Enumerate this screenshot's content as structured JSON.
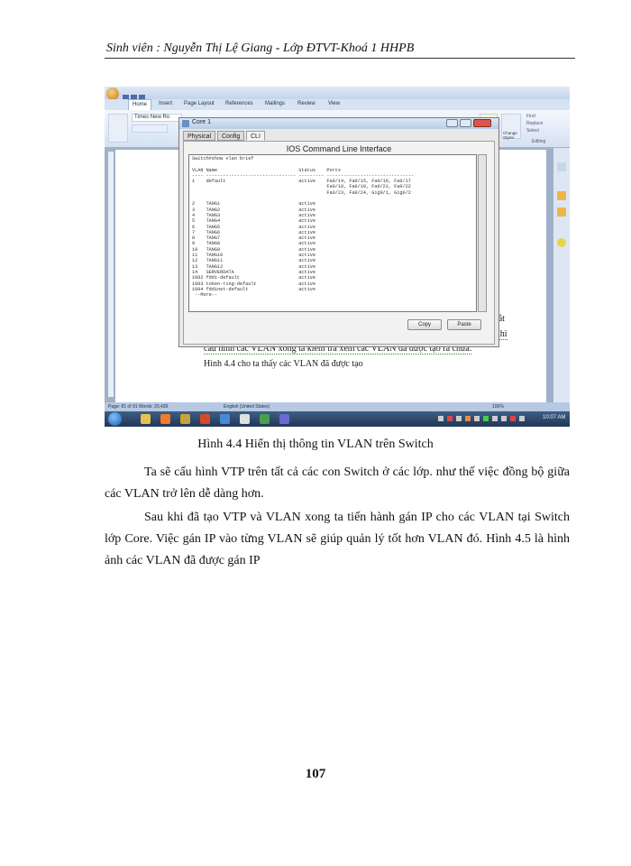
{
  "header": {
    "text": "Sinh viên : Nguyễn Thị Lệ Giang - Lớp ĐTVT-Khoá 1 HHPB"
  },
  "screenshot": {
    "word_tabs": [
      "Home",
      "Insert",
      "Page Layout",
      "References",
      "Mailings",
      "Review",
      "View"
    ],
    "font_box": "Times New Ro",
    "ribbon_right": [
      "Find",
      "Replace",
      "Select",
      "Change Styles",
      "Editing"
    ],
    "doc_lines": [
      "cấu hình các VLAN xong ta kiểm tra xem các VLAN đã được tạo ra chưa.",
      "Hình 4.4 cho ta thấy các VLAN đã được tạo"
    ],
    "doc_right_fragments": [
      "N bắt",
      "ý.Khi"
    ],
    "status_left": "Page: 81 of 91    Words: 20,439",
    "status_lang": "English (United States)",
    "zoom": "100%",
    "tray_time": "10:07 AM",
    "cli": {
      "title": "Core 1",
      "tabs": [
        "Physical",
        "Config",
        "CLI"
      ],
      "heading": "IOS Command Line Interface",
      "terminal_lines": [
        "Switch#show vlan brief",
        "",
        "VLAN Name                             Status    Ports",
        "---- -------------------------------- --------- -------------------------------",
        "1    default                          active    Fa0/14, Fa0/15, Fa0/16, Fa0/17",
        "                                                Fa0/18, Fa0/19, Fa0/21, Fa0/22",
        "                                                Fa0/23, Fa0/24, Gig0/1, Gig0/2",
        "",
        "2    TANG1                            active",
        "3    TANG2                            active",
        "4    TANG3                            active",
        "5    TANG4                            active",
        "6    TANG5                            active",
        "7    TANG6                            active",
        "8    TANG7                            active",
        "9    TANG8                            active",
        "10   TANG9                            active",
        "11   TANG10                           active",
        "12   TANG11                           active",
        "13   TANG12                           active",
        "14   SERVERDATA                       active",
        "1002 fddi-default                     active",
        "1003 token-ring-default               active",
        "1004 fddinet-default                  active",
        " --More--"
      ],
      "copy_label": "Copy",
      "paste_label": "Paste"
    }
  },
  "caption": "Hình 4.4 Hiển thị thông tin VLAN  trên Switch",
  "paragraphs": [
    "Ta sẽ cấu hình VTP trên tất cả các con Switch ở các lớp. như thế việc đồng bộ giữa các VLAN  trở lên dễ dàng hơn.",
    "Sau khi đã tạo VTP và VLAN  xong ta tiến hành gán IP cho các VLAN  tại Switch lớp Core. Việc gán IP vào từng VLAN  sẽ giúp quản lý tốt hơn VLAN đó. Hình 4.5 là hình ảnh các VLAN  đã được gán IP"
  ],
  "page_number": "107"
}
